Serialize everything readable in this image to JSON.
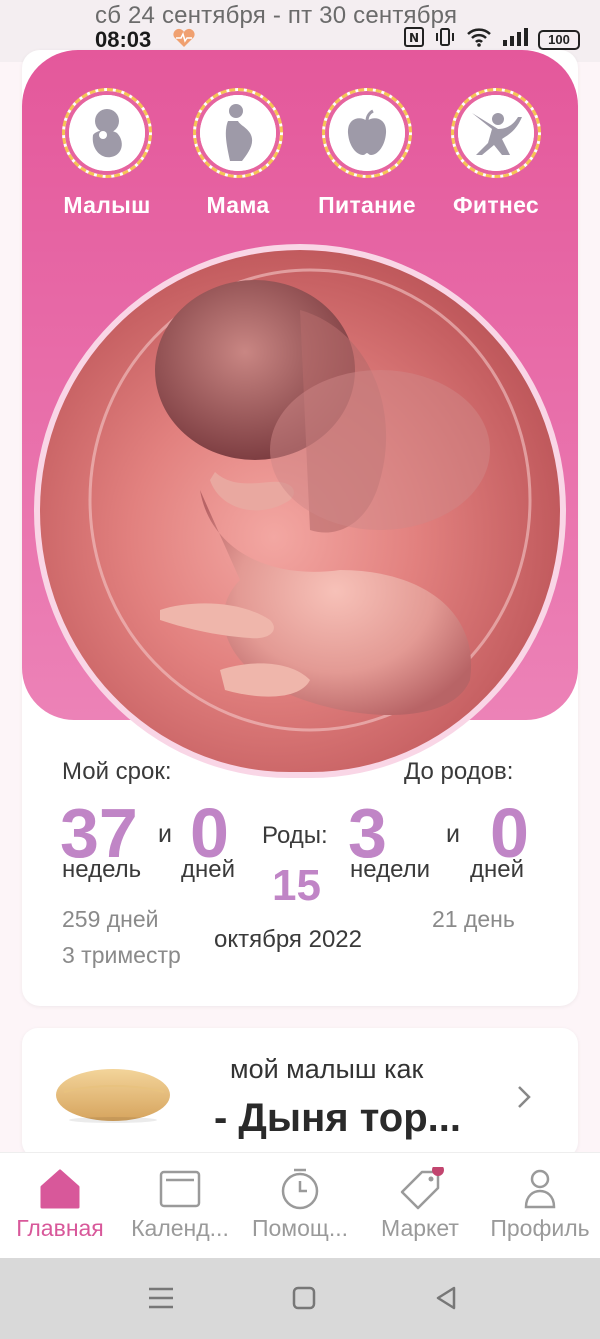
{
  "status_bar": {
    "week_range": "сб 24 сентября - пт 30 сентября",
    "time": "08:03",
    "battery": "100"
  },
  "categories": [
    {
      "label": "Малыш",
      "icon": "baby-icon"
    },
    {
      "label": "Мама",
      "icon": "pregnant-woman-icon"
    },
    {
      "label": "Питание",
      "icon": "apple-icon"
    },
    {
      "label": "Фитнес",
      "icon": "yoga-icon"
    }
  ],
  "term": {
    "my_term_label": "Мой срок:",
    "due_label": "До родов:",
    "weeks_value": "37",
    "and1": "и",
    "days_value": "0",
    "weeks_unit": "недель",
    "days_unit": "дней",
    "birth_label": "Роды:",
    "birth_day": "15",
    "birth_month_year": "октября 2022",
    "left_weeks_value": "3",
    "and2": "и",
    "left_days_value": "0",
    "left_weeks_unit": "недели",
    "left_days_unit": "дней",
    "total_days": "259 дней",
    "trimester": "3 триместр",
    "days_left": "21 день"
  },
  "baby_size": {
    "caption": "мой малыш как",
    "fruit": "- Дыня тор..."
  },
  "tabs": [
    {
      "label": "Главная",
      "icon": "home-icon",
      "active": true
    },
    {
      "label": "Календ...",
      "icon": "calendar-icon",
      "active": false
    },
    {
      "label": "Помощ...",
      "icon": "timer-icon",
      "active": false
    },
    {
      "label": "Маркет",
      "icon": "tag-icon",
      "active": false
    },
    {
      "label": "Профиль",
      "icon": "profile-icon",
      "active": false
    }
  ],
  "colors": {
    "brand_pink": "#e4589b",
    "accent_purple": "#c085c6",
    "active_tab": "#d8589a",
    "dashed_ring": "#f6c455"
  }
}
